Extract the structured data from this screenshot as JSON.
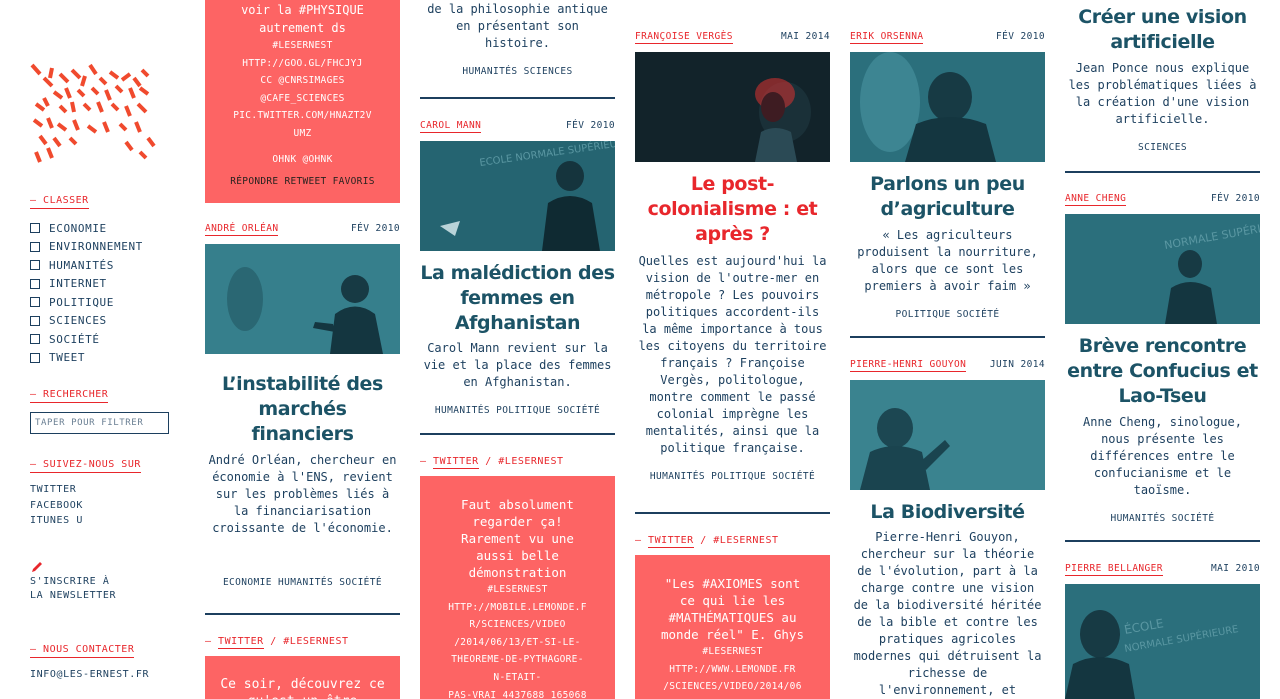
{
  "sidebar": {
    "classer_title": "CLASSER",
    "categories": [
      "ECONOMIE",
      "ENVIRONNEMENT",
      "HUMANITÉS",
      "INTERNET",
      "POLITIQUE",
      "SCIENCES",
      "SOCIÉTÉ",
      "TWEET"
    ],
    "search_title": "RECHERCHER",
    "search_placeholder": "TAPER POUR FILTRER",
    "follow_title": "SUIVEZ-NOUS SUR",
    "social": [
      "TWITTER",
      "FACEBOOK",
      "ITUNES U"
    ],
    "newsletter_line1": "S'INSCRIRE À",
    "newsletter_line2": "LA NEWSLETTER",
    "contact_title": "NOUS CONTACTER",
    "contact_email": "INFO@LES-ERNEST.FR"
  },
  "col1": {
    "tweet_top": {
      "line1": "voir la #PHYSIQUE",
      "line2": "autrement ds",
      "lines_small": [
        "#LESERNEST",
        "HTTP://GOO.GL/FHCJYJ",
        "CC @CNRSIMAGES",
        "@CAFE_SCIENCES",
        "PIC.TWITTER.COM/HNAZT2V",
        "UMZ"
      ],
      "handle": "OHNK @OHNK",
      "actions": "RÉPONDRE RETWEET FAVORIS"
    },
    "card": {
      "author": "ANDRÉ ORLÉAN",
      "date": "FÉV 2010",
      "title": "L’instabilité des marchés financiers",
      "desc": "André Orléan, chercheur en économie à l'ENS, revient sur les problèmes liés à la financiarisation croissante de l'économie.",
      "tags": "ECONOMIE HUMANITÉS SOCIÉTÉ"
    },
    "tweet_bottom": {
      "label": "TWITTER",
      "hashtag": "/ #LESERNEST",
      "text": "Ce soir, découvrez ce qu'est un être"
    }
  },
  "col2": {
    "top": {
      "desc": "de la philosophie antique en présentant son histoire.",
      "tags": "HUMANITÉS SCIENCES"
    },
    "card": {
      "author": "CAROL MANN",
      "date": "FÉV 2010",
      "title": "La malédiction des femmes en Afghanistan",
      "desc": "Carol Mann revient sur la vie et la place des femmes en Afghanistan.",
      "tags": "HUMANITÉS POLITIQUE SOCIÉTÉ"
    },
    "tweet": {
      "label": "TWITTER",
      "hashtag": "/ #LESERNEST",
      "text": "Faut absolument regarder ça! Rarement vu une aussi belle démonstration",
      "lines_small": [
        "#LESERNEST",
        "HTTP://MOBILE.LEMONDE.F",
        "R/SCIENCES/VIDEO",
        "/2014/06/13/ET-SI-LE-",
        "THEOREME-DE-PYTHAGORE-",
        "N-ETAIT-",
        "PAS-VRAI_4437688_165068"
      ]
    }
  },
  "col3": {
    "card": {
      "author": "FRANÇOISE VERGÈS",
      "date": "MAI 2014",
      "title": "Le post-colonialisme : et après ?",
      "desc": "Quelles est aujourd'hui la vision de l'outre-mer en métropole ? Les pouvoirs politiques accordent-ils la même importance à tous les citoyens du territoire français ? Françoise Vergès, politologue, montre comment le passé colonial imprègne les mentalités, ainsi que la politique française.",
      "tags": "HUMANITÉS POLITIQUE SOCIÉTÉ"
    },
    "tweet": {
      "label": "TWITTER",
      "hashtag": "/ #LESERNEST",
      "text": "\"Les #AXIOMES sont ce qui lie les #MATHÉMATIQUES au monde réel\" E. Ghys",
      "lines_small": [
        "#LESERNEST",
        "HTTP://WWW.LEMONDE.FR",
        "/SCIENCES/VIDEO/2014/06"
      ]
    }
  },
  "col4": {
    "card1": {
      "author": "ERIK ORSENNA",
      "date": "FÉV 2010",
      "title": "Parlons un peu d’agriculture",
      "desc": "« Les agriculteurs produisent la nourriture, alors que ce sont les premiers à avoir faim »",
      "tags": "POLITIQUE SOCIÉTÉ"
    },
    "card2": {
      "author": "PIERRE-HENRI GOUYON",
      "date": "JUIN 2014",
      "title": "La Biodiversité",
      "desc": "Pierre-Henri Gouyon, chercheur sur la théorie de l'évolution, part à la charge contre une vision de la biodiversité héritée de la bible  et contre les pratiques agricoles modernes qui détruisent la richesse de l'environnement, et"
    }
  },
  "col5": {
    "top": {
      "title": "Créer une vision artificielle",
      "desc": "Jean Ponce nous explique les problématiques liées à la création d'une vision artificielle.",
      "tags": "SCIENCES"
    },
    "card": {
      "author": "ANNE CHENG",
      "date": "FÉV 2010",
      "title": "Brève rencontre entre Confucius et Lao-Tseu",
      "desc": "Anne Cheng, sinologue, nous présente les différences entre le confucianisme et le taoïsme.",
      "tags": "HUMANITÉS SOCIÉTÉ"
    },
    "card2": {
      "author": "PIERRE BELLANGER",
      "date": "MAI 2010"
    }
  },
  "colors": {
    "accent_red": "#e8272c",
    "tweet_bg": "#fd6464",
    "navy": "#1c3f5e",
    "teal_title": "#1c5366",
    "photo_teal": "#2b6f7c"
  }
}
